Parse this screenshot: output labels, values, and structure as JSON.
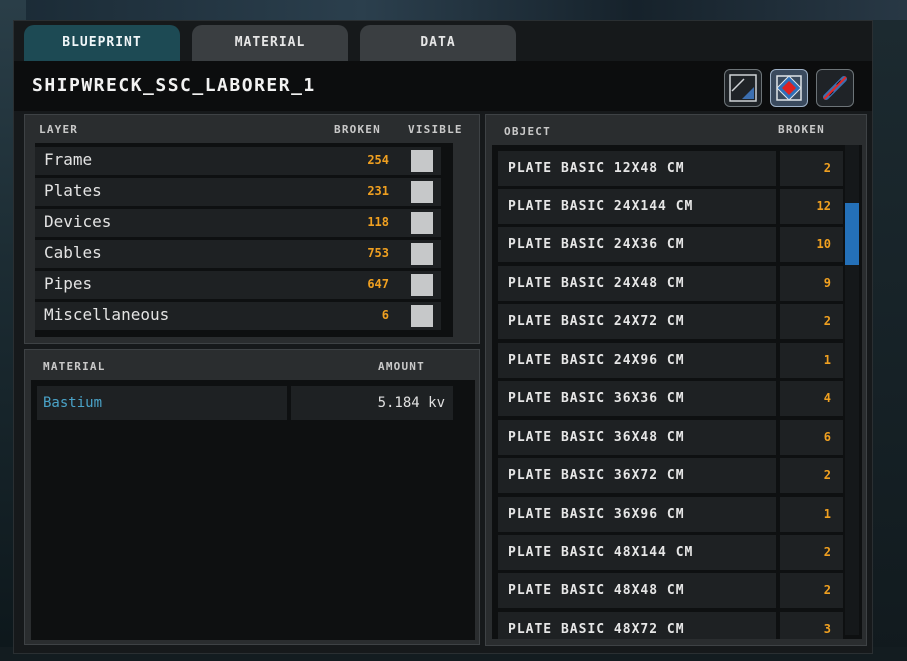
{
  "tabs": [
    {
      "label": "BLUEPRINT",
      "active": true
    },
    {
      "label": "MATERIAL",
      "active": false
    },
    {
      "label": "DATA",
      "active": false
    }
  ],
  "title": "SHIPWRECK_SSC_LABORER_1",
  "tool_buttons": [
    "corner-triangle-icon",
    "diamond-target-icon",
    "link-cut-icon"
  ],
  "layers": {
    "headers": {
      "layer": "LAYER",
      "broken": "BROKEN",
      "visible": "VISIBLE"
    },
    "rows": [
      {
        "name": "Frame",
        "broken": "254"
      },
      {
        "name": "Plates",
        "broken": "231"
      },
      {
        "name": "Devices",
        "broken": "118"
      },
      {
        "name": "Cables",
        "broken": "753"
      },
      {
        "name": "Pipes",
        "broken": "647"
      },
      {
        "name": "Miscellaneous",
        "broken": "6"
      }
    ]
  },
  "materials": {
    "headers": {
      "material": "MATERIAL",
      "amount": "AMOUNT"
    },
    "rows": [
      {
        "name": "Bastium",
        "amount": "5.184 kv"
      }
    ]
  },
  "objects": {
    "headers": {
      "object": "OBJECT",
      "broken": "BROKEN"
    },
    "rows": [
      {
        "name": "PLATE BASIC 12X48 CM",
        "broken": "2"
      },
      {
        "name": "PLATE BASIC 24X144 CM",
        "broken": "12"
      },
      {
        "name": "PLATE BASIC 24X36 CM",
        "broken": "10"
      },
      {
        "name": "PLATE BASIC 24X48 CM",
        "broken": "9"
      },
      {
        "name": "PLATE BASIC 24X72 CM",
        "broken": "2"
      },
      {
        "name": "PLATE BASIC 24X96 CM",
        "broken": "1"
      },
      {
        "name": "PLATE BASIC 36X36 CM",
        "broken": "4"
      },
      {
        "name": "PLATE BASIC 36X48 CM",
        "broken": "6"
      },
      {
        "name": "PLATE BASIC 36X72 CM",
        "broken": "2"
      },
      {
        "name": "PLATE BASIC 36X96 CM",
        "broken": "1"
      },
      {
        "name": "PLATE BASIC 48X144 CM",
        "broken": "2"
      },
      {
        "name": "PLATE BASIC 48X48 CM",
        "broken": "2"
      },
      {
        "name": "PLATE BASIC 48X72 CM",
        "broken": "3"
      }
    ]
  },
  "colors": {
    "accent_tab": "#1d4a54",
    "number": "#f0a020",
    "material_name": "#4aa3c8",
    "scrollbar": "#2470b8"
  }
}
